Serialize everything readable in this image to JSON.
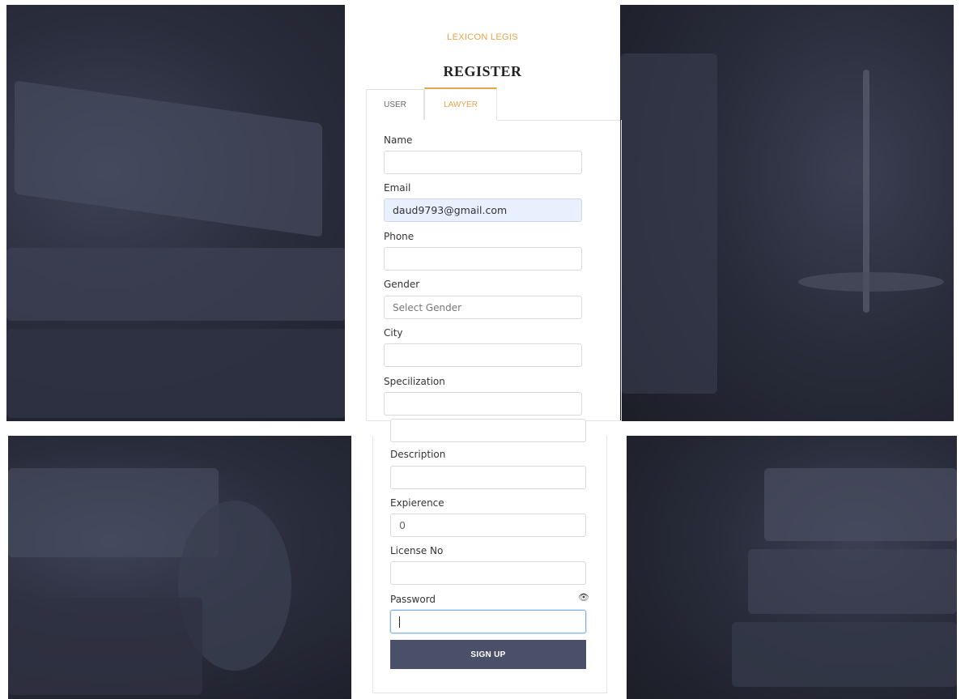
{
  "brand": "LEXICON LEGIS",
  "title": "REGISTER",
  "tabs": [
    {
      "label": "USER",
      "active": false
    },
    {
      "label": "LAWYER",
      "active": true
    }
  ],
  "fields": {
    "name": {
      "label": "Name",
      "value": ""
    },
    "email": {
      "label": "Email",
      "value": "daud9793@gmail.com"
    },
    "phone": {
      "label": "Phone",
      "value": ""
    },
    "gender": {
      "label": "Gender",
      "placeholder": "Select Gender"
    },
    "city": {
      "label": "City",
      "value": ""
    },
    "specialization": {
      "label": "Specilization",
      "value": ""
    },
    "description": {
      "label": "Description",
      "value": ""
    },
    "experience": {
      "label": "Expierence",
      "value": "0"
    },
    "license": {
      "label": "License No",
      "value": ""
    },
    "password": {
      "label": "Password",
      "value": ""
    }
  },
  "submit_label": "SIGN UP",
  "icons": {
    "password_toggle": "eye-icon"
  },
  "colors": {
    "accent": "#e8a24a",
    "button": "#4a5068",
    "background": "#2a2d3c"
  }
}
